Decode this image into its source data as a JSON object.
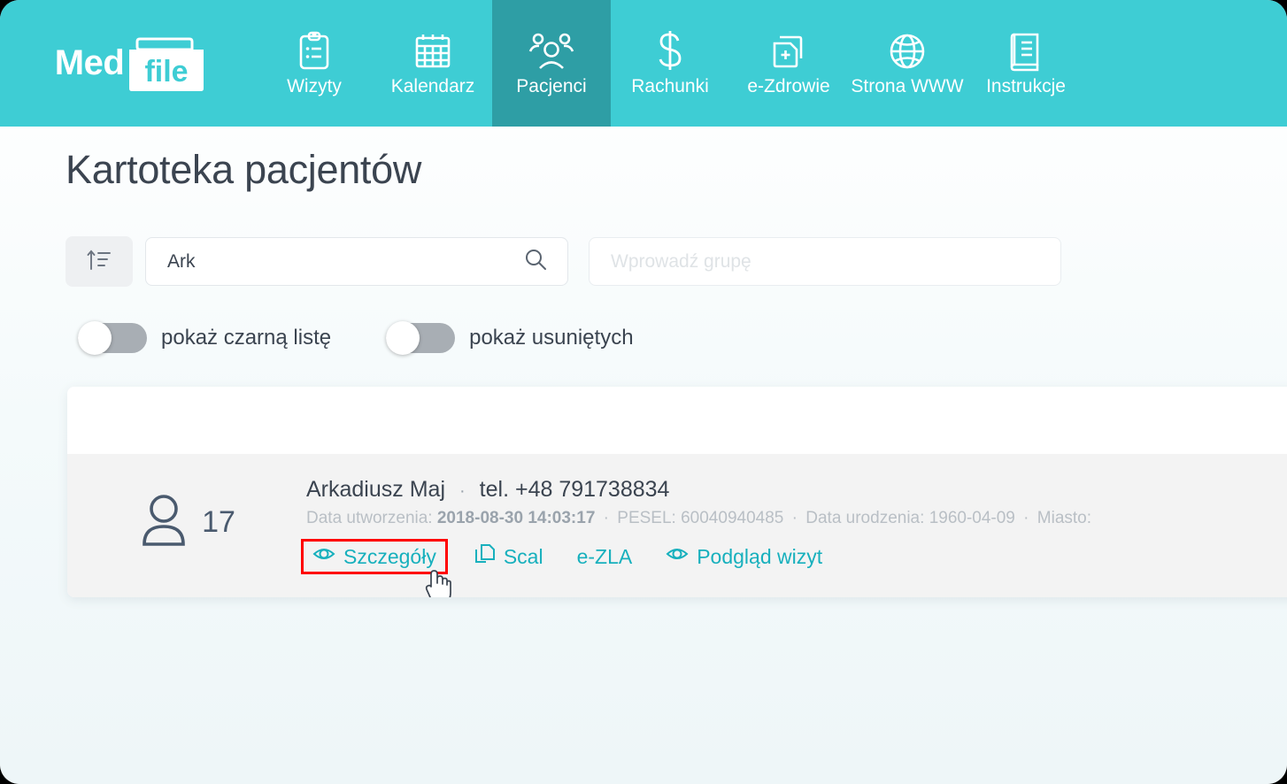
{
  "brand": {
    "name_part1": "Med",
    "name_part2": "file",
    "teal": "#3ecdd4",
    "active_teal": "#2e9ea5",
    "link_teal": "#17b0bd",
    "highlight_red": "#ff0000"
  },
  "nav": {
    "items": [
      {
        "label": "Wizyty",
        "icon": "clipboard-icon",
        "active": false
      },
      {
        "label": "Kalendarz",
        "icon": "calendar-icon",
        "active": false
      },
      {
        "label": "Pacjenci",
        "icon": "people-icon",
        "active": true
      },
      {
        "label": "Rachunki",
        "icon": "dollar-icon",
        "active": false
      },
      {
        "label": "e-Zdrowie",
        "icon": "documents-plus-icon",
        "active": false
      },
      {
        "label": "Strona WWW",
        "icon": "globe-icon",
        "active": false
      },
      {
        "label": "Instrukcje",
        "icon": "book-icon",
        "active": false
      }
    ]
  },
  "page": {
    "title": "Kartoteka pacjentów"
  },
  "filters": {
    "sort_icon": "sort-ascending-icon",
    "search": {
      "value": "Ark",
      "placeholder": "",
      "icon": "search-icon"
    },
    "group": {
      "value": "",
      "placeholder": "Wprowadź grupę"
    },
    "toggles": [
      {
        "label": "pokaż czarną listę",
        "checked": false
      },
      {
        "label": "pokaż usuniętych",
        "checked": false
      }
    ]
  },
  "patients": [
    {
      "count": "17",
      "avatar_icon": "user-icon",
      "name": "Arkadiusz Maj",
      "separator": "·",
      "phone": "tel. +48 791738834",
      "meta": {
        "created_label": "Data utworzenia:",
        "created_value": "2018-08-30 14:03:17",
        "pesel_label": "PESEL:",
        "pesel_value": "60040940485",
        "birth_label": "Data urodzenia:",
        "birth_value": "1960-04-09",
        "city_label": "Miasto:"
      },
      "actions": [
        {
          "label": "Szczegóły",
          "icon": "eye-icon",
          "highlighted": true
        },
        {
          "label": "Scal",
          "icon": "copy-icon",
          "highlighted": false
        },
        {
          "label": "e-ZLA",
          "icon": "",
          "highlighted": false
        },
        {
          "label": "Podgląd wizyt",
          "icon": "eye-icon",
          "highlighted": false
        }
      ]
    }
  ]
}
